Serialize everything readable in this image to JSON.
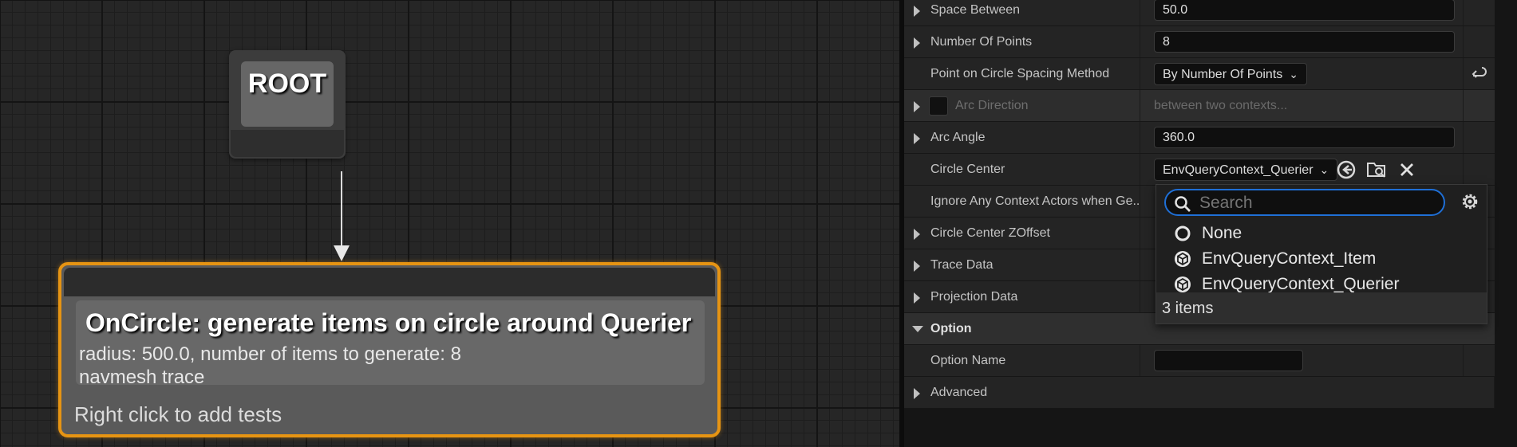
{
  "graph": {
    "root_node": {
      "title": "ROOT"
    },
    "generator_node": {
      "title": "OnCircle: generate items on circle around Querier",
      "description_line1": "radius: 500.0, number of items to generate: 8",
      "description_line2": "navmesh trace",
      "hint": "Right click to add tests"
    }
  },
  "details": {
    "rows": [
      {
        "id": "space-between",
        "label": "Space Between",
        "expandable": true,
        "value": "50.0"
      },
      {
        "id": "number-of-points",
        "label": "Number Of Points",
        "expandable": true,
        "value": "8"
      },
      {
        "id": "spacing-method",
        "label": "Point on Circle Spacing Method",
        "expandable": false,
        "value": "By Number Of Points"
      },
      {
        "id": "arc-direction",
        "label": "Arc Direction",
        "expandable": true,
        "value": "between two contexts...",
        "disabled": true
      },
      {
        "id": "arc-angle",
        "label": "Arc Angle",
        "expandable": true,
        "value": "360.0"
      },
      {
        "id": "circle-center",
        "label": "Circle Center",
        "expandable": false,
        "value": "EnvQueryContext_Querier"
      },
      {
        "id": "ignore-context",
        "label": "Ignore Any Context Actors when Ge...",
        "expandable": false
      },
      {
        "id": "circle-center-zoffset",
        "label": "Circle Center ZOffset",
        "expandable": true
      },
      {
        "id": "trace-data",
        "label": "Trace Data",
        "expandable": true
      },
      {
        "id": "projection-data",
        "label": "Projection Data",
        "expandable": true
      },
      {
        "id": "option",
        "label": "Option",
        "category": true
      },
      {
        "id": "option-name",
        "label": "Option Name",
        "expandable": false,
        "value": ""
      },
      {
        "id": "advanced",
        "label": "Advanced",
        "expandable": true
      }
    ]
  },
  "picker": {
    "search_placeholder": "Search",
    "items": [
      {
        "label": "None",
        "icon": "none-circle-icon"
      },
      {
        "label": "EnvQueryContext_Item",
        "icon": "blueprint-class-icon"
      },
      {
        "label": "EnvQueryContext_Querier",
        "icon": "blueprint-class-icon"
      }
    ],
    "count_label": "3 items"
  },
  "colors": {
    "node_selection": "#e69413",
    "search_focus": "#1f6fd6",
    "panel_bg": "#242424"
  }
}
